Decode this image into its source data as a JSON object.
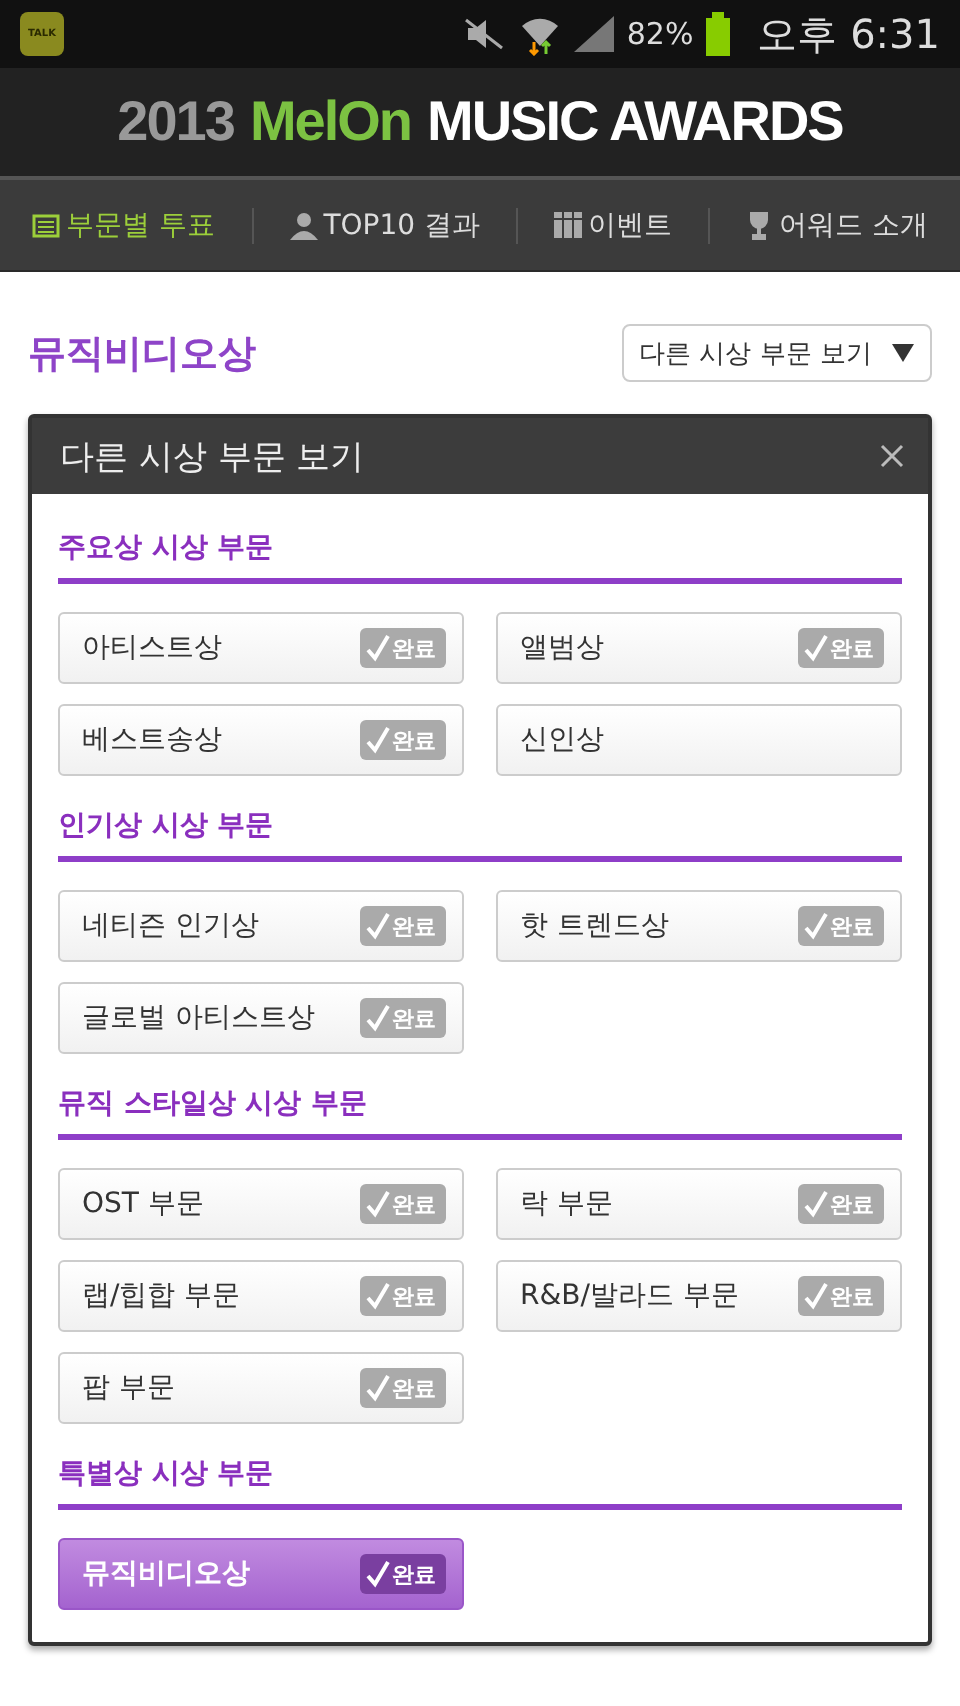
{
  "status_bar": {
    "app_icon_text": "TALK",
    "battery": "82%",
    "time": "오후 6:31"
  },
  "header": {
    "year": "2013",
    "brand": "MelOn",
    "title": "MUSIC AWARDS"
  },
  "nav": [
    {
      "label": "부문별 투표",
      "selected": true
    },
    {
      "label": "TOP10 결과",
      "selected": false
    },
    {
      "label": "이벤트",
      "selected": false
    },
    {
      "label": "어워드 소개",
      "selected": false
    }
  ],
  "page_title": "뮤직비디오상",
  "dropdown": {
    "label": "다른 시상 부문 보기"
  },
  "modal": {
    "title": "다른 시상 부문 보기",
    "sections": [
      {
        "heading": "주요상 시상 부문",
        "items": [
          {
            "label": "아티스트상",
            "badge": "완료",
            "selected": false
          },
          {
            "label": "앨범상",
            "badge": "완료",
            "selected": false
          },
          {
            "label": "베스트송상",
            "badge": "완료",
            "selected": false
          },
          {
            "label": "신인상",
            "selected": false
          }
        ]
      },
      {
        "heading": "인기상 시상 부문",
        "items": [
          {
            "label": "네티즌 인기상",
            "badge": "완료",
            "selected": false
          },
          {
            "label": "핫 트렌드상",
            "badge": "완료",
            "selected": false
          },
          {
            "label": "글로벌 아티스트상",
            "badge": "완료",
            "selected": false
          }
        ]
      },
      {
        "heading": "뮤직 스타일상 시상 부문",
        "items": [
          {
            "label": "OST 부문",
            "badge": "완료",
            "selected": false
          },
          {
            "label": "락 부문",
            "badge": "완료",
            "selected": false
          },
          {
            "label": "랩/힙합 부문",
            "badge": "완료",
            "selected": false
          },
          {
            "label": "R&B/발라드 부문",
            "badge": "완료",
            "selected": false
          },
          {
            "label": "팝 부문",
            "badge": "완료",
            "selected": false
          }
        ]
      },
      {
        "heading": "특별상 시상 부문",
        "items": [
          {
            "label": "뮤직비디오상",
            "badge": "완료",
            "selected": true
          }
        ]
      }
    ]
  }
}
